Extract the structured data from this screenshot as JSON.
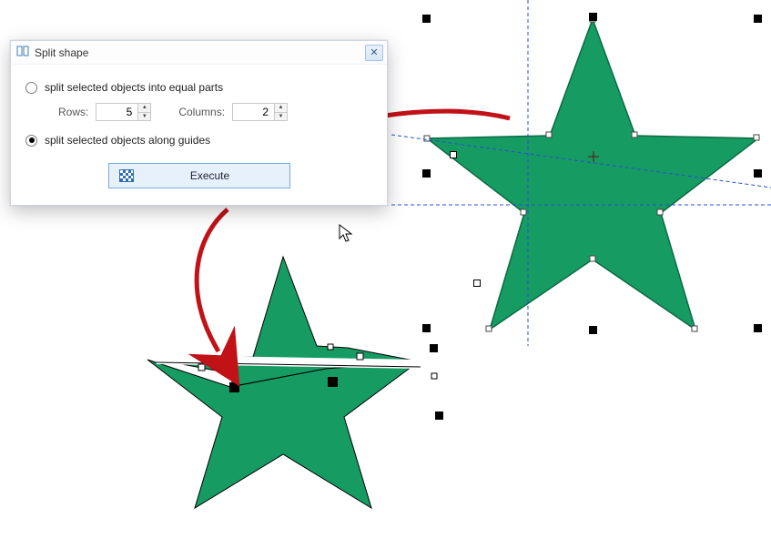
{
  "dialog": {
    "title": "Split shape",
    "option_equal": "split selected objects into equal parts",
    "option_guides": "split selected objects along guides",
    "rows_label": "Rows:",
    "rows_value": "5",
    "cols_label": "Columns:",
    "cols_value": "2",
    "execute_label": "Execute",
    "selected": "guides"
  },
  "colors": {
    "star_fill": "#169c62",
    "star_stroke": "#0b6a42",
    "arrow": "#c01217",
    "guide": "#2a4ed8"
  }
}
